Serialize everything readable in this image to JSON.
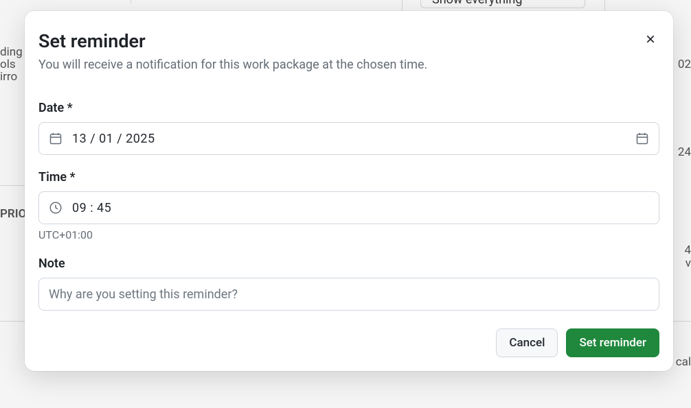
{
  "background": {
    "dropdown_label": "Show everything",
    "left_fragments": [
      "ding",
      "ols",
      "irro"
    ],
    "right_fragments": [
      "02",
      "24",
      "v",
      "cal",
      "4"
    ],
    "prio_label": "PRIO"
  },
  "modal": {
    "title": "Set reminder",
    "subtitle": "You will receive a notification for this work package at the chosen time.",
    "date": {
      "label": "Date *",
      "value": "13 / 01 / 2025"
    },
    "time": {
      "label": "Time *",
      "value": "09 : 45",
      "timezone": "UTC+01:00"
    },
    "note": {
      "label": "Note",
      "placeholder": "Why are you setting this reminder?",
      "value": ""
    },
    "buttons": {
      "cancel": "Cancel",
      "submit": "Set reminder"
    }
  }
}
